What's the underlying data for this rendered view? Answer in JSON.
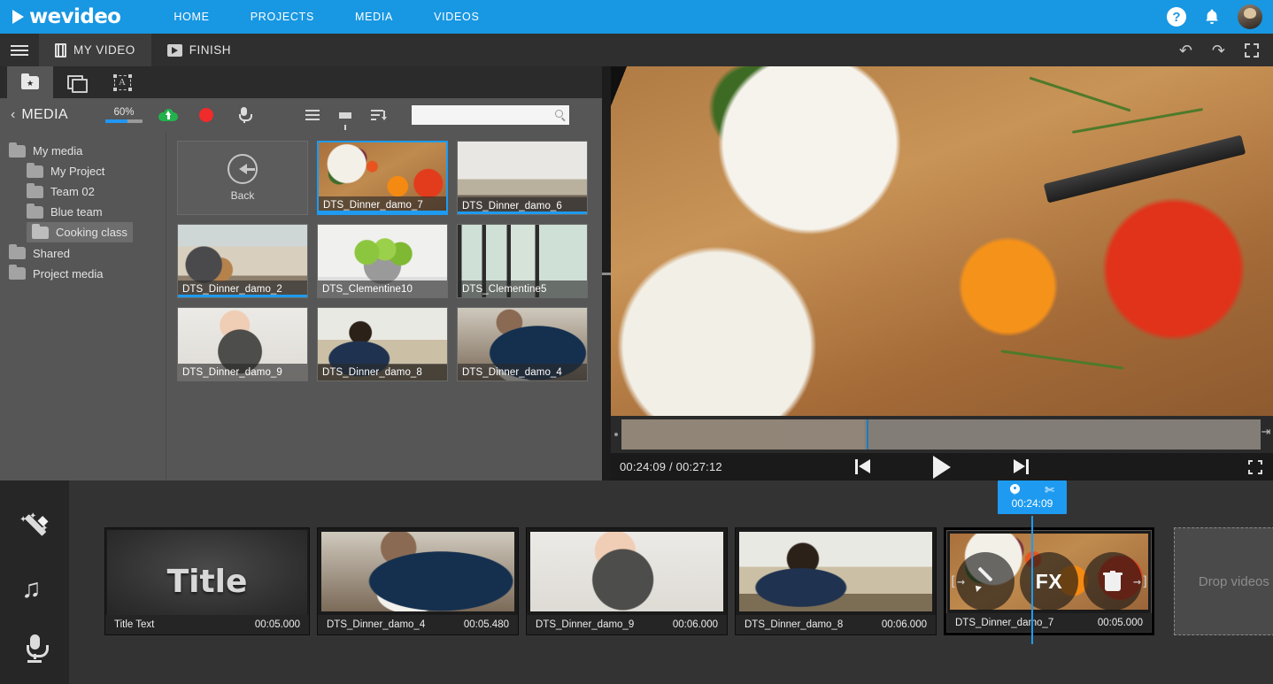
{
  "topbar": {
    "brand": "wevideo",
    "nav": [
      {
        "label": "HOME",
        "name": "nav-home"
      },
      {
        "label": "PROJECTS",
        "name": "nav-projects"
      },
      {
        "label": "MEDIA",
        "name": "nav-media"
      },
      {
        "label": "VIDEOS",
        "name": "nav-videos"
      }
    ],
    "help_glyph": "?",
    "bell_glyph": "✉",
    "accent_color": "#1897e2"
  },
  "subbar": {
    "tabs": [
      {
        "label": "MY VIDEO",
        "icon": "film-icon",
        "active": true
      },
      {
        "label": "FINISH",
        "icon": "finish-icon",
        "active": false
      }
    ],
    "undo_glyph": "↶",
    "redo_glyph": "↷"
  },
  "media_panel": {
    "tabs": [
      {
        "name": "tab-media-library",
        "icon": "folder-star-icon",
        "active": true
      },
      {
        "name": "tab-transitions",
        "icon": "images-icon",
        "active": false
      },
      {
        "name": "tab-text",
        "icon": "text-box-icon",
        "active": false
      }
    ],
    "title": "MEDIA",
    "back_chevron": "‹",
    "storage": {
      "percent_label": "60%",
      "percent_value": 60,
      "fill_color": "#2196f3"
    },
    "toolbar": {
      "upload_icon": "cloud-upload-icon",
      "record_icon": "record-dot-icon",
      "voiceover_icon": "microphone-icon",
      "list_icon": "list-view-icon",
      "filter_icon": "filter-icon",
      "sort_icon": "sort-icon"
    },
    "search": {
      "value": "",
      "placeholder": ""
    },
    "folders": [
      {
        "label": "My media",
        "level": 1,
        "selected": false
      },
      {
        "label": "My Project",
        "level": 2,
        "selected": false
      },
      {
        "label": "Team 02",
        "level": 2,
        "selected": false
      },
      {
        "label": "Blue team",
        "level": 2,
        "selected": false
      },
      {
        "label": "Cooking class",
        "level": 2,
        "selected": true
      },
      {
        "label": "Shared",
        "level": 1,
        "selected": false
      },
      {
        "label": "Project media",
        "level": 1,
        "selected": false
      }
    ],
    "back_cell": {
      "label": "Back",
      "icon": "back-arrow-circle-icon"
    },
    "items": [
      {
        "name": "DTS_Dinner_damo_7",
        "art": "img-salad",
        "selected": true,
        "progress": 100
      },
      {
        "name": "DTS_Dinner_damo_6",
        "art": "img-kitchen",
        "selected": false,
        "progress": 100
      },
      {
        "name": "DTS_Dinner_damo_2",
        "art": "img-shelf",
        "selected": false,
        "progress": 100
      },
      {
        "name": "DTS_Clementine10",
        "art": "img-apples",
        "selected": false,
        "progress": 0
      },
      {
        "name": "DTS_Clementine5",
        "art": "img-windows",
        "selected": false,
        "progress": 0
      },
      {
        "name": "DTS_Dinner_damo_9",
        "art": "img-mortar",
        "selected": false,
        "progress": 0
      },
      {
        "name": "DTS_Dinner_damo_8",
        "art": "img-backchef",
        "selected": false,
        "progress": 0
      },
      {
        "name": "DTS_Dinner_damo_4",
        "art": "img-chef",
        "selected": false,
        "progress": 0
      }
    ]
  },
  "preview": {
    "current_time": "00:24:09",
    "total_time": "00:27:12",
    "timecode_display": "00:24:09 / 00:27:12",
    "controls": {
      "prev_label": "skip-to-start",
      "play_label": "play",
      "next_label": "skip-to-end",
      "fullscreen_label": "fullscreen"
    }
  },
  "rail": {
    "buttons": [
      {
        "name": "effects-wand-button",
        "icon": "magic-wand-icon"
      },
      {
        "name": "audio-button",
        "icon": "music-note-icon"
      },
      {
        "name": "voiceover-button",
        "icon": "microphone-icon"
      }
    ]
  },
  "timeline": {
    "playhead": {
      "time": "00:24:09",
      "pin_icon": "pin-icon",
      "split_icon": "scissors-icon"
    },
    "clips": [
      {
        "name": "Title Text",
        "duration": "00:05.000",
        "art": "img-title",
        "is_title": true,
        "title_text": "Title",
        "selected": false
      },
      {
        "name": "DTS_Dinner_damo_4",
        "duration": "00:05.480",
        "art": "img-chef",
        "is_title": false,
        "selected": false
      },
      {
        "name": "DTS_Dinner_damo_9",
        "duration": "00:06.000",
        "art": "img-mortar",
        "is_title": false,
        "selected": false
      },
      {
        "name": "DTS_Dinner_damo_8",
        "duration": "00:06.000",
        "art": "img-backchef",
        "is_title": false,
        "selected": false
      },
      {
        "name": "DTS_Dinner_damo_7",
        "duration": "00:05.000",
        "art": "img-salad",
        "is_title": false,
        "selected": true
      }
    ],
    "selected_clip_overlay": {
      "edit_label": "edit",
      "fx_label": "FX",
      "delete_label": "delete",
      "trim_left_glyph": "[→",
      "trim_right_glyph": "→]"
    },
    "drop_zone_text": "Drop videos or images here"
  }
}
